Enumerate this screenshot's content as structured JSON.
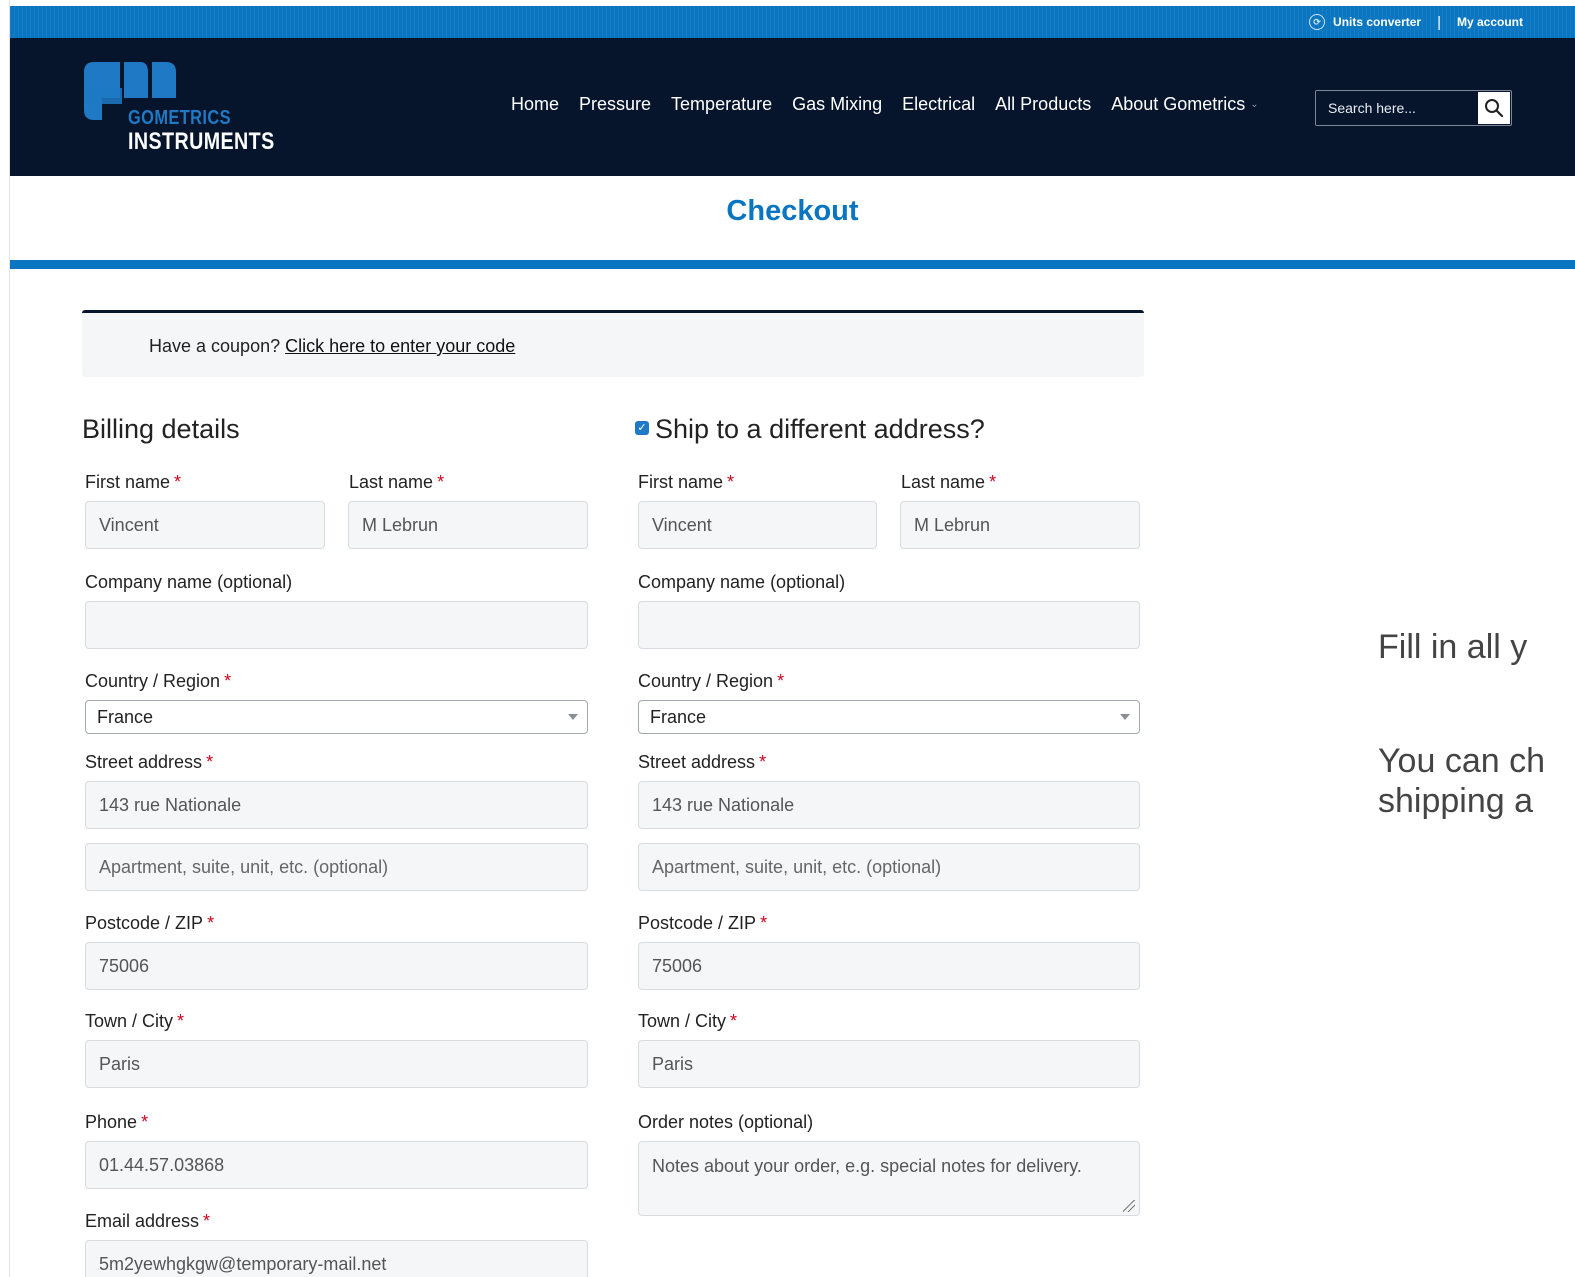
{
  "topbar": {
    "units_converter": "Units converter",
    "separator": "|",
    "my_account": "My account"
  },
  "logo": {
    "line1": "GOMETRICS",
    "line2": "INSTRUMENTS"
  },
  "nav": {
    "items": [
      "Home",
      "Pressure",
      "Temperature",
      "Gas Mixing",
      "Electrical",
      "All Products",
      "About Gometrics"
    ]
  },
  "search": {
    "placeholder": "Search here..."
  },
  "page": {
    "title": "Checkout"
  },
  "coupon": {
    "text": "Have a coupon?",
    "link": "Click here to enter your code"
  },
  "billing": {
    "heading": "Billing details",
    "first_name_label": "First name",
    "first_name": "Vincent",
    "last_name_label": "Last name",
    "last_name": "M Lebrun",
    "company_label": "Company name (optional)",
    "company": "",
    "country_label": "Country / Region",
    "country": "France",
    "street_label": "Street address",
    "street": "143 rue Nationale",
    "apartment_placeholder": "Apartment, suite, unit, etc. (optional)",
    "postcode_label": "Postcode / ZIP",
    "postcode": "75006",
    "city_label": "Town / City",
    "city": "Paris",
    "phone_label": "Phone",
    "phone": "01.44.57.03868",
    "email_label": "Email address",
    "email": "5m2yewhgkgw@temporary-mail.net"
  },
  "shipping": {
    "heading": "Ship to a different address?",
    "checked": true,
    "first_name_label": "First name",
    "first_name": "Vincent",
    "last_name_label": "Last name",
    "last_name": "M Lebrun",
    "company_label": "Company name (optional)",
    "company": "",
    "country_label": "Country / Region",
    "country": "France",
    "street_label": "Street address",
    "street": "143 rue Nationale",
    "apartment_placeholder": "Apartment, suite, unit, etc. (optional)",
    "postcode_label": "Postcode / ZIP",
    "postcode": "75006",
    "city_label": "Town / City",
    "city": "Paris",
    "notes_label": "Order notes (optional)",
    "notes_placeholder": "Notes about your order, e.g. special notes for delivery."
  },
  "required_marker": "*",
  "side_note": {
    "line1": "Fill in all y",
    "line2": "You can ch",
    "line3": "shipping a"
  },
  "colors": {
    "brand_blue": "#0a75c0",
    "navbar": "#06152c",
    "required": "#d0021b"
  }
}
